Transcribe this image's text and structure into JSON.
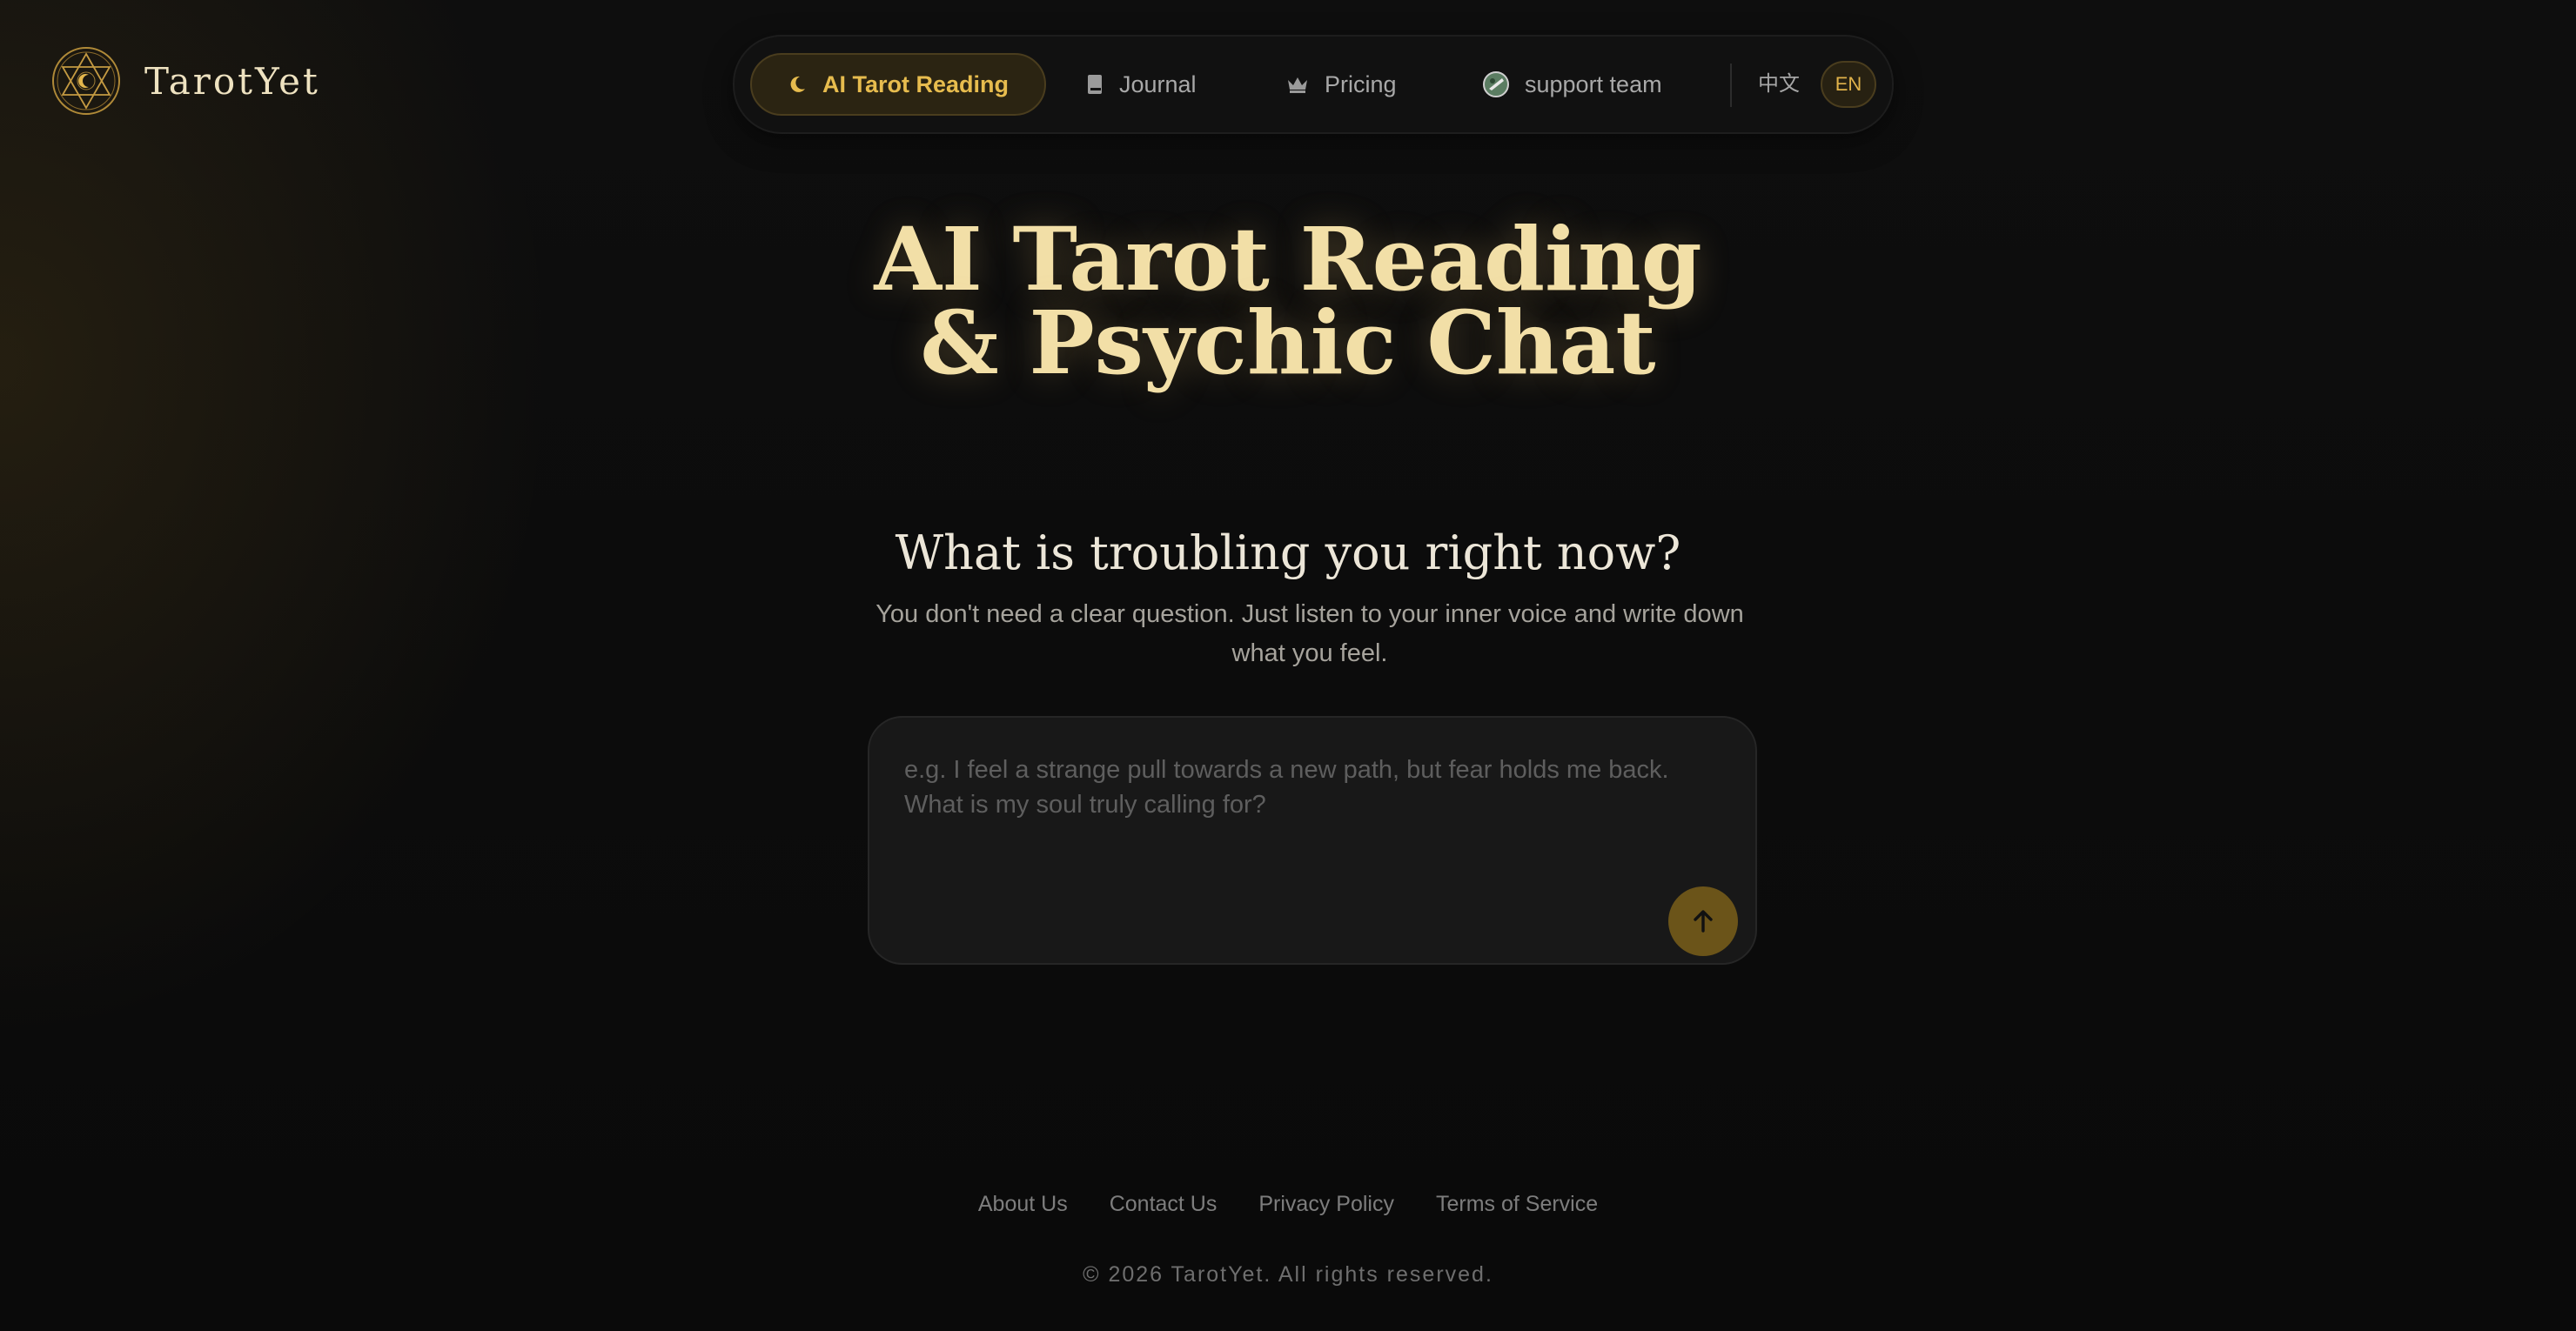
{
  "brand": {
    "name": "TarotYet",
    "logo_icon": "hexagram-moon-icon",
    "accent_color": "#e7bc4e"
  },
  "nav": {
    "items": [
      {
        "label": "AI Tarot Reading",
        "icon": "moon-icon",
        "active": true
      },
      {
        "label": "Journal",
        "icon": "book-icon",
        "active": false
      },
      {
        "label": "Pricing",
        "icon": "crown-icon",
        "active": false
      },
      {
        "label": "support team",
        "icon": "avatar-icon",
        "active": false
      }
    ],
    "languages": {
      "zh": "中文",
      "en": "EN",
      "selected": "EN"
    }
  },
  "hero": {
    "title_line1": "AI Tarot Reading",
    "title_line2": "& Psychic Chat"
  },
  "prompt": {
    "title": "What is troubling you right now?",
    "subtitle": "You don't need a clear question. Just listen to your inner voice and write down what you feel.",
    "input_value": "",
    "placeholder": "e.g. I feel a strange pull towards a new path, but fear holds me back. What is my soul truly calling for?",
    "send_icon": "arrow-up-icon"
  },
  "footer": {
    "links": [
      "About Us",
      "Contact Us",
      "Privacy Policy",
      "Terms of Service"
    ],
    "copyright": "© 2026 TarotYet. All rights reserved."
  }
}
